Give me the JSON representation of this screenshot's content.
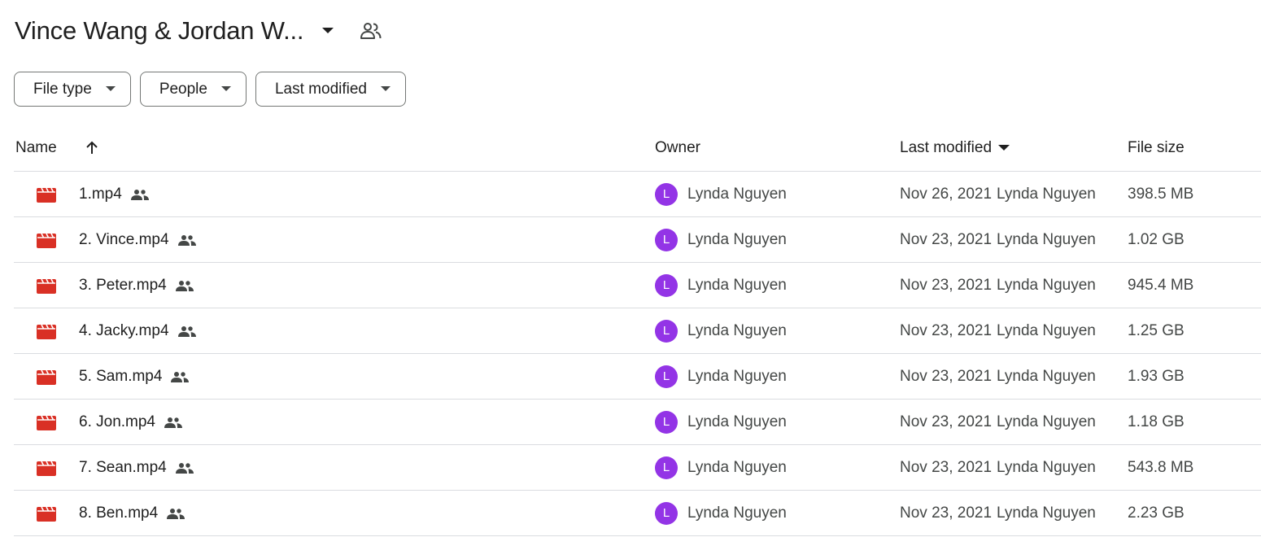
{
  "folder": {
    "title": "Vince Wang & Jordan W..."
  },
  "filters": [
    {
      "label": "File type"
    },
    {
      "label": "People"
    },
    {
      "label": "Last modified"
    }
  ],
  "columns": {
    "name": "Name",
    "owner": "Owner",
    "last_modified": "Last modified",
    "file_size": "File size"
  },
  "colors": {
    "video_icon": "#d93025",
    "avatar": "#9334e6",
    "divider": "#dadce0"
  },
  "icons": {
    "title_dropdown": "caret-down-icon",
    "title_shared": "people-outline-icon",
    "sort": "arrow-up-icon",
    "file": "video-file-icon",
    "shared": "people-icon"
  },
  "files": [
    {
      "name": "1.mp4",
      "owner_initial": "L",
      "owner": "Lynda Nguyen",
      "modified_date": "Nov 26, 2021",
      "modified_by": "Lynda Nguyen",
      "size": "398.5 MB"
    },
    {
      "name": "2. Vince.mp4",
      "owner_initial": "L",
      "owner": "Lynda Nguyen",
      "modified_date": "Nov 23, 2021",
      "modified_by": "Lynda Nguyen",
      "size": "1.02 GB"
    },
    {
      "name": "3. Peter.mp4",
      "owner_initial": "L",
      "owner": "Lynda Nguyen",
      "modified_date": "Nov 23, 2021",
      "modified_by": "Lynda Nguyen",
      "size": "945.4 MB"
    },
    {
      "name": "4. Jacky.mp4",
      "owner_initial": "L",
      "owner": "Lynda Nguyen",
      "modified_date": "Nov 23, 2021",
      "modified_by": "Lynda Nguyen",
      "size": "1.25 GB"
    },
    {
      "name": "5. Sam.mp4",
      "owner_initial": "L",
      "owner": "Lynda Nguyen",
      "modified_date": "Nov 23, 2021",
      "modified_by": "Lynda Nguyen",
      "size": "1.93 GB"
    },
    {
      "name": "6. Jon.mp4",
      "owner_initial": "L",
      "owner": "Lynda Nguyen",
      "modified_date": "Nov 23, 2021",
      "modified_by": "Lynda Nguyen",
      "size": "1.18 GB"
    },
    {
      "name": "7. Sean.mp4",
      "owner_initial": "L",
      "owner": "Lynda Nguyen",
      "modified_date": "Nov 23, 2021",
      "modified_by": "Lynda Nguyen",
      "size": "543.8 MB"
    },
    {
      "name": "8. Ben.mp4",
      "owner_initial": "L",
      "owner": "Lynda Nguyen",
      "modified_date": "Nov 23, 2021",
      "modified_by": "Lynda Nguyen",
      "size": "2.23 GB"
    }
  ]
}
